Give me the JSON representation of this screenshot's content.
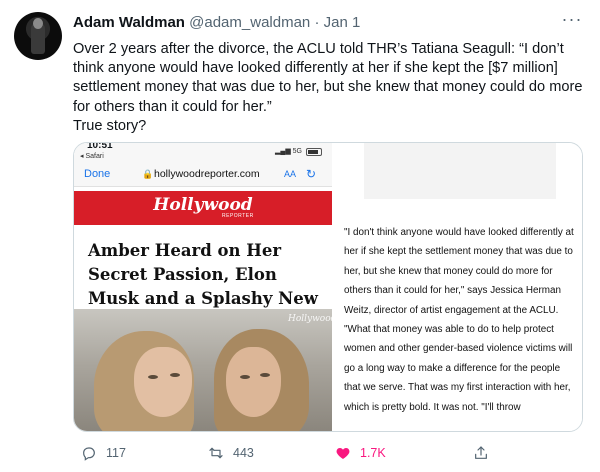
{
  "tweet": {
    "display_name": "Adam Waldman",
    "handle": "@adam_waldman",
    "separator": "·",
    "date": "Jan 1",
    "text_main": "Over 2 years after the divorce, the ACLU told THR’s Tatiana Seagull: “I don’t think anyone would have looked differently at her if she kept the [$7 million] settlement money that was due to her, but she knew that money could do more for others than it could for her.”",
    "text_tail": "True story?",
    "more_label": "···"
  },
  "media": {
    "phone": {
      "time": "10:51",
      "back_label": "◂ Safari",
      "signal_label": "▂▄▆ 5G",
      "done_label": "Done",
      "url": "hollywoodreporter.com",
      "aa_label": "AA",
      "banner_logo": "Hollywood",
      "banner_sub": "REPORTER",
      "headline": "Amber Heard on Her Secret Passion, Elon Musk and a Splashy New Role",
      "photo_watermark": "Hollywood"
    },
    "article": {
      "quote": "\"I don't think anyone would have looked differently at her if she kept the settlement money that was due to her, but she knew that money could do more for others than it could for her,\" says Jessica Herman Weitz, director of artist engagement at the ACLU. \"What that money was able to do to help protect women and other gender-based violence victims will go a long way to make a difference for the people that we serve. That was my first interaction with her, which is pretty bold. It was not. \"I'll throw"
    }
  },
  "actions": {
    "reply_count": "117",
    "retweet_count": "443",
    "like_count": "1.7K",
    "like_color": "#f91880"
  }
}
